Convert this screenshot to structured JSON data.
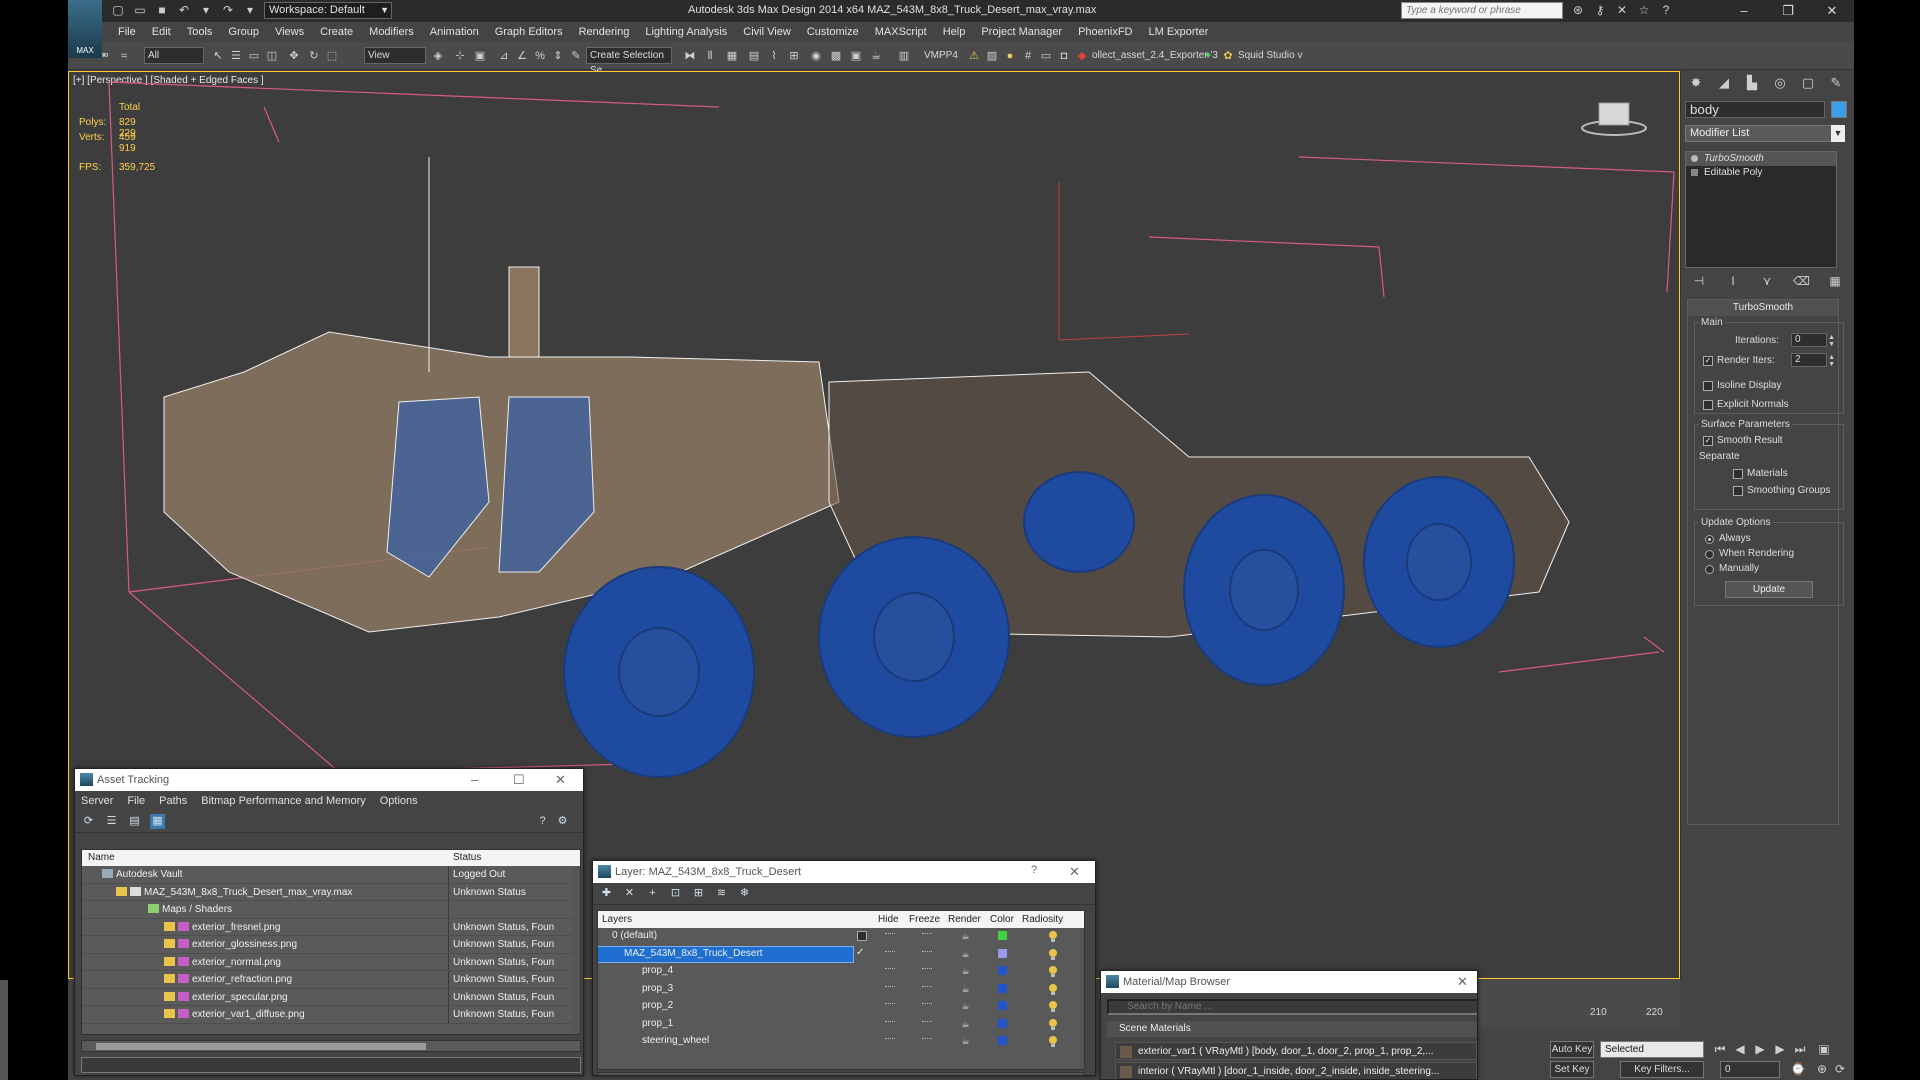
{
  "app": {
    "logo_text": "MAX",
    "window_title": "Autodesk 3ds Max Design 2014 x64     MAZ_543M_8x8_Truck_Desert_max_vray.max",
    "workspace": "Workspace: Default",
    "search_placeholder": "Type a keyword or phrase",
    "accent_color": "#ffcc33"
  },
  "menu": [
    "File",
    "Edit",
    "Tools",
    "Group",
    "Views",
    "Create",
    "Modifiers",
    "Animation",
    "Graph Editors",
    "Rendering",
    "Lighting Analysis",
    "Civil View",
    "Customize",
    "MAXScript",
    "Help",
    "Project Manager",
    "PhoenixFD",
    "LM Exporter"
  ],
  "toolbar": {
    "selection_filter": "All",
    "ref_coord": "View",
    "named_selection": "Create Selection Se",
    "vmpp_label": "VMPP4",
    "exporter_label": "ollect_asset_2.4_Exporter '3",
    "squid_label": "Squid Studio v"
  },
  "viewport": {
    "label": "[+] [Perspective ] [Shaded + Edged Faces ]",
    "stats_header": "Total",
    "polys_label": "Polys:",
    "polys_value": "829 229",
    "verts_label": "Verts:",
    "verts_value": "459 919",
    "fps_label": "FPS:",
    "fps_value": "359,725"
  },
  "command_panel": {
    "object_name": "body",
    "object_color": "#3a9ee8",
    "modifier_list": "Modifier List",
    "stack": [
      "TurboSmooth",
      "Editable Poly"
    ],
    "rollout_title": "TurboSmooth",
    "main_group": "Main",
    "iterations_label": "Iterations:",
    "iterations_value": "0",
    "render_iters_label": "Render Iters:",
    "render_iters_value": "2",
    "isoline_label": "Isoline Display",
    "explicit_normals_label": "Explicit Normals",
    "surface_group": "Surface Parameters",
    "smooth_result_label": "Smooth Result",
    "separate_label": "Separate",
    "materials_label": "Materials",
    "smoothing_groups_label": "Smoothing Groups",
    "update_group": "Update Options",
    "always_label": "Always",
    "when_rendering_label": "When Rendering",
    "manually_label": "Manually",
    "update_button": "Update"
  },
  "asset_tracking": {
    "title": "Asset Tracking",
    "menu": [
      "Server",
      "File",
      "Paths",
      "Bitmap Performance and Memory",
      "Options"
    ],
    "columns": [
      "Name",
      "Status"
    ],
    "rows": [
      {
        "name": "Autodesk Vault",
        "status": "Logged Out",
        "indent": 0,
        "icon": "vault-icon"
      },
      {
        "name": "MAZ_543M_8x8_Truck_Desert_max_vray.max",
        "status": "Unknown Status",
        "indent": 1,
        "icon": "max-file-icon"
      },
      {
        "name": "Maps / Shaders",
        "status": "",
        "indent": 2,
        "icon": "folder-icon"
      },
      {
        "name": "exterior_fresnel.png",
        "status": "Unknown Status, Foun",
        "indent": 3,
        "icon": "png-icon"
      },
      {
        "name": "exterior_glossiness.png",
        "status": "Unknown Status, Foun",
        "indent": 3,
        "icon": "png-icon"
      },
      {
        "name": "exterior_normal.png",
        "status": "Unknown Status, Foun",
        "indent": 3,
        "icon": "png-icon"
      },
      {
        "name": "exterior_refraction.png",
        "status": "Unknown Status, Foun",
        "indent": 3,
        "icon": "png-icon"
      },
      {
        "name": "exterior_specular.png",
        "status": "Unknown Status, Foun",
        "indent": 3,
        "icon": "png-icon"
      },
      {
        "name": "exterior_var1_diffuse.png",
        "status": "Unknown Status, Foun",
        "indent": 3,
        "icon": "png-icon"
      }
    ]
  },
  "layer_window": {
    "title": "Layer: MAZ_543M_8x8_Truck_Desert",
    "help": "?",
    "columns": [
      "Layers",
      "Hide",
      "Freeze",
      "Render",
      "Color",
      "Radiosity"
    ],
    "rows": [
      {
        "name": "0 (default)",
        "color": "#40d040",
        "indent": 0,
        "selected": false
      },
      {
        "name": "MAZ_543M_8x8_Truck_Desert",
        "color": "#9a9ae8",
        "indent": 0,
        "selected": true
      },
      {
        "name": "prop_4",
        "color": "#2255cc",
        "indent": 1,
        "selected": false
      },
      {
        "name": "prop_3",
        "color": "#2255cc",
        "indent": 1,
        "selected": false
      },
      {
        "name": "prop_2",
        "color": "#2255cc",
        "indent": 1,
        "selected": false
      },
      {
        "name": "prop_1",
        "color": "#2255cc",
        "indent": 1,
        "selected": false
      },
      {
        "name": "steering_wheel",
        "color": "#2255cc",
        "indent": 1,
        "selected": false
      }
    ]
  },
  "material_browser": {
    "title": "Material/Map Browser",
    "search_placeholder": "Search by Name ...",
    "group": "Scene Materials",
    "items": [
      "exterior_var1  ( VRayMtl ) [body, door_1, door_2, prop_1, prop_2,...",
      "interior  ( VRayMtl ) [door_1_inside, door_2_inside, inside_steering..."
    ]
  },
  "timeline": {
    "ticks": [
      "210",
      "220"
    ]
  },
  "anim": {
    "auto_key": "Auto Key",
    "set_key": "Set Key",
    "key_mode": "Selected",
    "key_filters": "Key Filters...",
    "frame": "0"
  }
}
